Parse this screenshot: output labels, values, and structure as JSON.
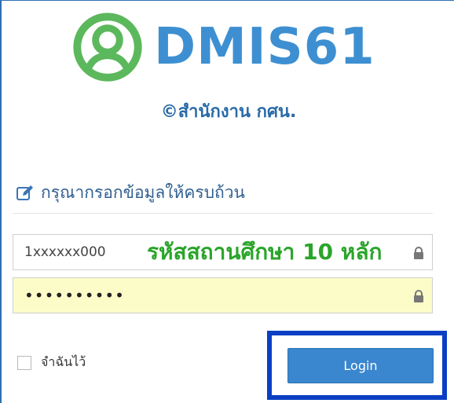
{
  "header": {
    "title": "DMIS61",
    "subtitle": "©สำนักงาน กศน.",
    "icon": "user-circle-icon"
  },
  "form": {
    "prompt": "กรุณากรอกข้อมูลให้ครบถ้วน",
    "prompt_icon": "edit-icon",
    "username": {
      "value": "1xxxxxx000",
      "overlay_label": "รหัสสถานศึกษา 10 หลัก",
      "lock_icon": "lock-icon"
    },
    "password": {
      "value": "••••••••••",
      "lock_icon": "lock-icon"
    },
    "remember_label": "จำฉันไว้",
    "login_label": "Login"
  },
  "colors": {
    "brand": "#3d8fd1",
    "icon_green": "#5cb85c",
    "overlay_green": "#2aa52a",
    "button": "#3a86cf",
    "highlight_border": "#0a3fc4",
    "autofill_bg": "#fbfcc8"
  }
}
